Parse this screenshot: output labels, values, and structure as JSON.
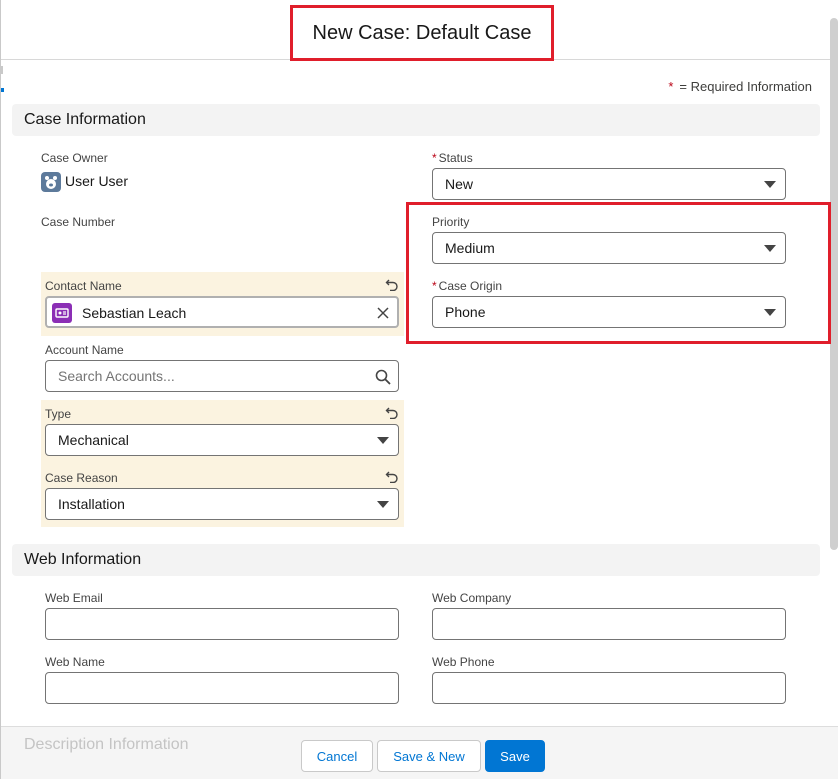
{
  "header": {
    "title": "New Case: Default Case"
  },
  "required_info": {
    "star": "*",
    "text": "= Required Information"
  },
  "sections": {
    "case_information": "Case Information",
    "web_information": "Web Information",
    "description_information": "Description Information"
  },
  "fields": {
    "case_owner": {
      "label": "Case Owner",
      "value": "User User"
    },
    "case_number": {
      "label": "Case Number"
    },
    "status": {
      "label": "Status",
      "required": "*",
      "value": "New"
    },
    "priority": {
      "label": "Priority",
      "value": "Medium"
    },
    "case_origin": {
      "label": "Case Origin",
      "required": "*",
      "value": "Phone"
    },
    "contact_name": {
      "label": "Contact Name",
      "value": "Sebastian Leach"
    },
    "account_name": {
      "label": "Account Name",
      "placeholder": "Search Accounts..."
    },
    "type": {
      "label": "Type",
      "value": "Mechanical"
    },
    "case_reason": {
      "label": "Case Reason",
      "value": "Installation"
    },
    "web_email": {
      "label": "Web Email",
      "value": ""
    },
    "web_company": {
      "label": "Web Company",
      "value": ""
    },
    "web_name": {
      "label": "Web Name",
      "value": ""
    },
    "web_phone": {
      "label": "Web Phone",
      "value": ""
    }
  },
  "footer": {
    "cancel": "Cancel",
    "save_new": "Save & New",
    "save": "Save"
  },
  "colors": {
    "brand": "#0176d3",
    "highlight": "#e01e2b",
    "changed_bg": "#fbf3e0",
    "required": "#ba0517"
  },
  "icons": [
    "user-avatar-icon",
    "contact-card-icon",
    "clear-icon",
    "search-icon",
    "undo-icon",
    "chevron-down-icon"
  ]
}
